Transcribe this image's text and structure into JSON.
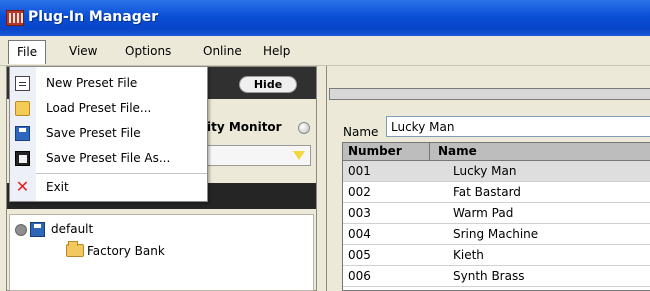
{
  "window": {
    "title": "Plug-In Manager"
  },
  "menubar": {
    "items": [
      "File",
      "View",
      "Options",
      "Online",
      "Help"
    ]
  },
  "file_menu": {
    "items": [
      {
        "label": "New Preset File",
        "icon": "new-file-icon"
      },
      {
        "label": "Load Preset File...",
        "icon": "folder-icon"
      },
      {
        "label": "Save Preset File",
        "icon": "save-icon"
      },
      {
        "label": "Save Preset File As...",
        "icon": "save-as-icon"
      },
      {
        "label": "Exit",
        "icon": "exit-icon"
      }
    ]
  },
  "left_panel": {
    "hide_button": "Hide",
    "monitor_label": "ity Monitor"
  },
  "preset_tree": {
    "items": [
      "default",
      "Factory Bank"
    ]
  },
  "right_panel": {
    "name_label": "Name",
    "name_value": "Lucky Man"
  },
  "preset_table": {
    "headers": [
      "Number",
      "Name"
    ],
    "rows": [
      {
        "number": "001",
        "name": "Lucky Man"
      },
      {
        "number": "002",
        "name": "Fat Bastard"
      },
      {
        "number": "003",
        "name": "Warm Pad"
      },
      {
        "number": "004",
        "name": "Sring Machine"
      },
      {
        "number": "005",
        "name": "Kieth"
      },
      {
        "number": "006",
        "name": "Synth Brass"
      }
    ]
  },
  "colors": {
    "title_bar": "#0a4fd6",
    "panel_background": "#ece9d8",
    "selected_row": "#dedede",
    "monitor_arrow": "#f2d73d"
  }
}
